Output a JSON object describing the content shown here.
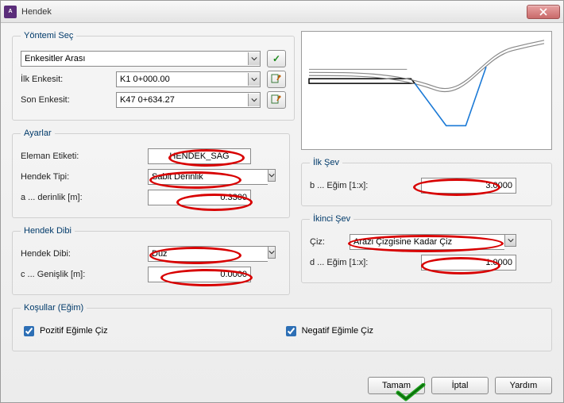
{
  "window": {
    "title": "Hendek"
  },
  "method": {
    "legend": "Yöntemi Seç",
    "mode": "Enkesitler Arası",
    "first_label": "İlk Enkesit:",
    "first_value": "K1 0+000.00",
    "last_label": "Son Enkesit:",
    "last_value": "K47 0+634.27"
  },
  "settings": {
    "legend": "Ayarlar",
    "label_label": "Eleman Etiketi:",
    "label_value": "HENDEK_SAĞ",
    "type_label": "Hendek Tipi:",
    "type_value": "Sabit Derinlik",
    "depth_label": "a ... derinlik [m]:",
    "depth_value": "0.3300"
  },
  "bottom": {
    "legend": "Hendek Dibi",
    "type_label": "Hendek Dibi:",
    "type_value": "Düz",
    "width_label": "c ... Genişlik [m]:",
    "width_value": "0.0000"
  },
  "slope1": {
    "legend": "İlk Şev",
    "label": "b ... Eğim [1:x]:",
    "value": "3.0000"
  },
  "slope2": {
    "legend": "İkinci Şev",
    "draw_label": "Çiz:",
    "draw_value": "Arazi Çizgisine Kadar Çiz",
    "slope_label": "d ... Eğim [1:x]:",
    "slope_value": "1.0000"
  },
  "conditions": {
    "legend": "Koşullar (Eğim)",
    "pos": "Pozitif Eğimle Çiz",
    "neg": "Negatif Eğimle Çiz"
  },
  "buttons": {
    "ok": "Tamam",
    "cancel": "İptal",
    "help": "Yardım"
  },
  "icons": {
    "confirm": "✓"
  }
}
